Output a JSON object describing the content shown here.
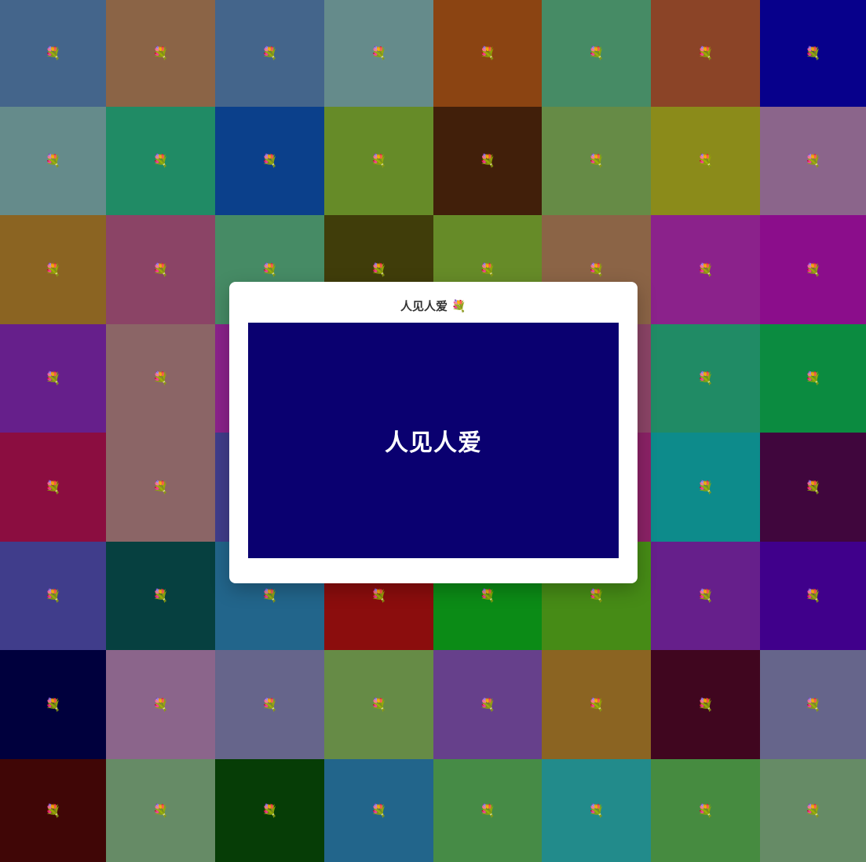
{
  "dialog": {
    "title": "人见人爱",
    "title_icon": "💐",
    "panel_text": "人见人爱",
    "panel_color": "#0a0070"
  },
  "tile_icon": "💐",
  "tiles": [
    {
      "color": "#44658b"
    },
    {
      "color": "#8b6446"
    },
    {
      "color": "#44658b"
    },
    {
      "color": "#658b8b"
    },
    {
      "color": "#8b4412"
    },
    {
      "color": "#468b65"
    },
    {
      "color": "#8b4427"
    },
    {
      "color": "#07008b"
    },
    {
      "color": "#658b8b"
    },
    {
      "color": "#208b65"
    },
    {
      "color": "#0b408b"
    },
    {
      "color": "#668b28"
    },
    {
      "color": "#411f0a"
    },
    {
      "color": "#668b46"
    },
    {
      "color": "#8b8b1a"
    },
    {
      "color": "#8b658b"
    },
    {
      "color": "#8b6422"
    },
    {
      "color": "#8b4466"
    },
    {
      "color": "#468b65"
    },
    {
      "color": "#403d0a"
    },
    {
      "color": "#668b28"
    },
    {
      "color": "#8b6446"
    },
    {
      "color": "#8b228b"
    },
    {
      "color": "#8b0d8b"
    },
    {
      "color": "#661f8b"
    },
    {
      "color": "#8b6566"
    },
    {
      "color": "#8b228b"
    },
    {
      "color": "#8b228b"
    },
    {
      "color": "#8b228b"
    },
    {
      "color": "#8b4466"
    },
    {
      "color": "#208b65"
    },
    {
      "color": "#0b8b40"
    },
    {
      "color": "#8b0d40"
    },
    {
      "color": "#8b6566"
    },
    {
      "color": "#403d8b"
    },
    {
      "color": "#403d8b"
    },
    {
      "color": "#8b228b"
    },
    {
      "color": "#8b2266"
    },
    {
      "color": "#0d8b8b"
    },
    {
      "color": "#40063d"
    },
    {
      "color": "#403d8b"
    },
    {
      "color": "#064040"
    },
    {
      "color": "#22658b"
    },
    {
      "color": "#8b0d0d"
    },
    {
      "color": "#0b8b16"
    },
    {
      "color": "#468b16"
    },
    {
      "color": "#661f8b"
    },
    {
      "color": "#40008b"
    },
    {
      "color": "#00003d"
    },
    {
      "color": "#8b658b"
    },
    {
      "color": "#66658b"
    },
    {
      "color": "#668b46"
    },
    {
      "color": "#66408b"
    },
    {
      "color": "#8b6422"
    },
    {
      "color": "#40061f"
    },
    {
      "color": "#66658b"
    },
    {
      "color": "#400606"
    },
    {
      "color": "#668b66"
    },
    {
      "color": "#063d06"
    },
    {
      "color": "#22658b"
    },
    {
      "color": "#468b46"
    },
    {
      "color": "#228b8b"
    },
    {
      "color": "#468b40"
    },
    {
      "color": "#668b66"
    }
  ]
}
